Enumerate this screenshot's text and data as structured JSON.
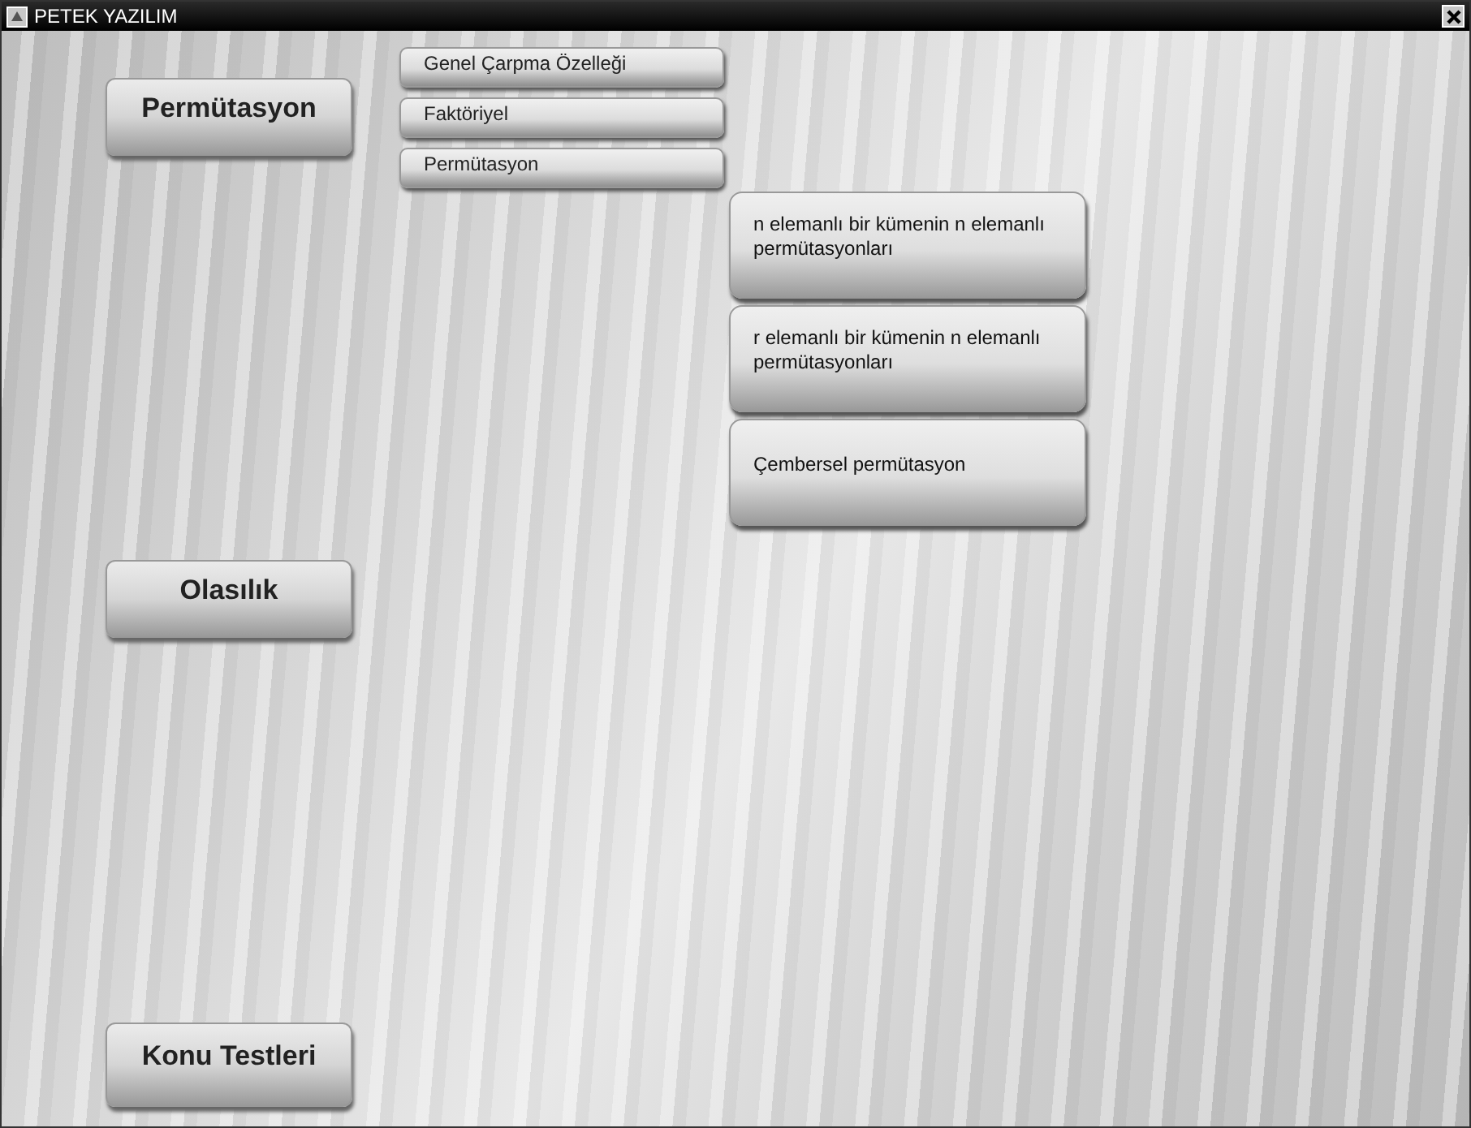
{
  "window": {
    "title": "PETEK YAZILIM"
  },
  "main_menu": [
    {
      "label": "Permütasyon"
    },
    {
      "label": "Olasılık"
    },
    {
      "label": "Konu Testleri"
    }
  ],
  "submenu": [
    {
      "label": "Genel Çarpma Özelleği"
    },
    {
      "label": "Faktöriyel"
    },
    {
      "label": "Permütasyon"
    }
  ],
  "permutation_topics": [
    {
      "label": "n elemanlı bir kümenin n elemanlı permütasyonları"
    },
    {
      "label": "r elemanlı bir kümenin n elemanlı permütasyonları"
    },
    {
      "label": "Çembersel permütasyon"
    }
  ]
}
